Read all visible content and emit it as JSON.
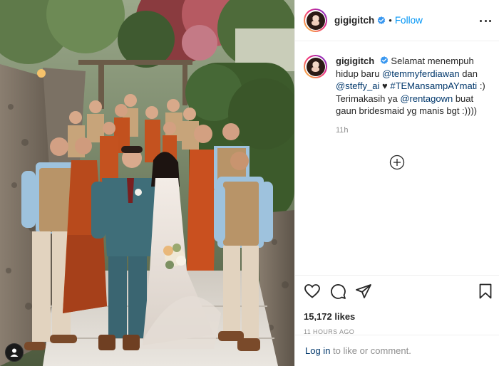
{
  "post": {
    "username": "gigigitch",
    "follow_label": "Follow",
    "separator": "•",
    "verified": true,
    "caption": {
      "text_1": "Selamat menempuh hidup baru ",
      "mention_1": "@temmyferdiawan",
      "text_2": " dan ",
      "mention_2": "@steffy_ai",
      "text_3": " ♥ ",
      "hashtag": "#TEMansampAYmati",
      "text_4": " :) Terimakasih ya ",
      "mention_3": "@rentagown",
      "text_5": " buat gaun bridesmaid yg manis bgt :))))"
    },
    "caption_time": "11h",
    "likes": "15,172 likes",
    "timestamp": "11 HOURS AGO",
    "comment": {
      "login_label": "Log in",
      "rest": " to like or comment."
    }
  },
  "icons": {
    "verified": "verified-badge-icon",
    "more": "more-options-icon",
    "load_more": "plus-circle-icon",
    "like": "heart-icon",
    "comment": "comment-bubble-icon",
    "share": "paper-plane-icon",
    "save": "bookmark-icon",
    "tagged_user": "user-tag-icon"
  },
  "colors": {
    "link": "#00376b",
    "follow": "#0095f6",
    "verified": "#3897f0",
    "muted": "#8e8e8e",
    "text": "#262626"
  }
}
